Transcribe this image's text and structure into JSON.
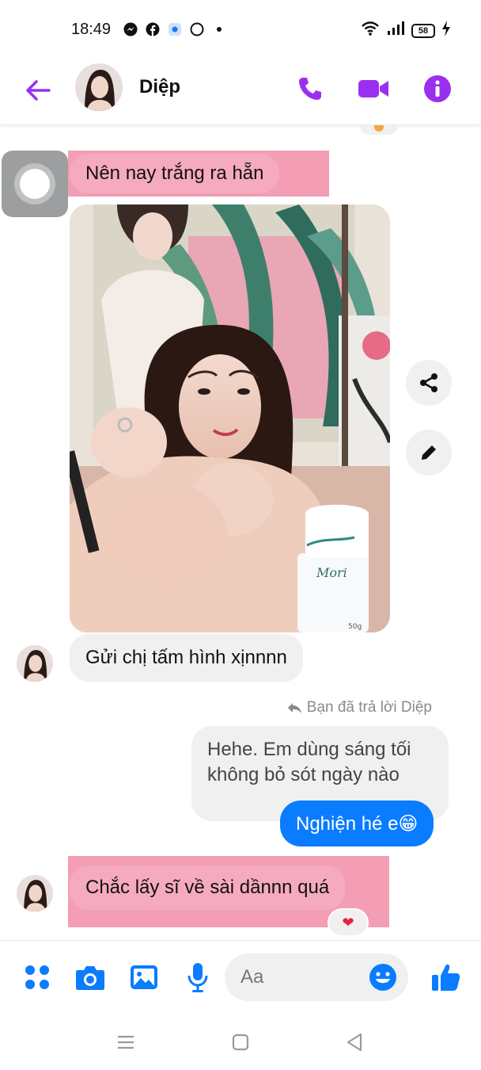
{
  "status_bar": {
    "time": "18:49",
    "battery": "58",
    "left_icons": [
      "messenger-icon",
      "facebook-icon",
      "app-icon",
      "circle-icon",
      "dot-icon"
    ],
    "right_icons": [
      "wifi-icon",
      "signal-icon",
      "battery-icon",
      "charging-icon"
    ]
  },
  "header": {
    "contact_name": "Diệp",
    "accent_color": "#9b2ff0",
    "actions": [
      "phone-icon",
      "video-icon",
      "info-icon"
    ]
  },
  "messages": {
    "incoming_1": "Nên nay trắng ra hẵn",
    "incoming_2": "Gửi chị tấm hình xịnnnn",
    "reply_meta": "Bạn đã trả lời Diệp",
    "outgoing_quoted": "Hehe. Em dùng sáng tối không bỏ sót ngày nào",
    "outgoing_1": "Nghiện hé e😁",
    "incoming_3": "Chắc lấy sĩ về sài dầnnn quá",
    "reaction": "❤"
  },
  "photo": {
    "product_text": [
      "Mori",
      "50g"
    ]
  },
  "composer": {
    "placeholder": "Aa",
    "accent_color": "#0a7cff",
    "actions": [
      "apps-icon",
      "camera-icon",
      "gallery-icon",
      "mic-icon",
      "emoji-icon",
      "like-icon"
    ]
  },
  "nav": [
    "menu-icon",
    "home-icon",
    "back-icon"
  ]
}
